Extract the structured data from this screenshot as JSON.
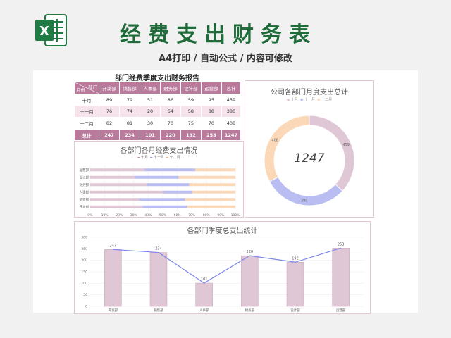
{
  "header": {
    "title": "经费支出财务表",
    "subtitle": "A4打印 / 自动公式 / 内容可修改"
  },
  "table": {
    "title": "部门经费季度支出财务报告",
    "corner_top": "部门",
    "corner_bottom": "月份",
    "columns": [
      "开发部",
      "销售部",
      "人事部",
      "财务部",
      "设计部",
      "运营部",
      "总计"
    ],
    "rows": [
      {
        "label": "十月",
        "values": [
          "89",
          "79",
          "51",
          "86",
          "59",
          "95",
          "459"
        ]
      },
      {
        "label": "十一月",
        "values": [
          "76",
          "74",
          "20",
          "64",
          "58",
          "88",
          "380"
        ]
      },
      {
        "label": "十二月",
        "values": [
          "82",
          "81",
          "30",
          "70",
          "75",
          "70",
          "408"
        ]
      }
    ],
    "total": {
      "label": "总计",
      "values": [
        "247",
        "234",
        "101",
        "220",
        "192",
        "253",
        "1247"
      ]
    }
  },
  "colors": {
    "accent": "#b97a9c",
    "pink": "#dfc7d6",
    "blue": "#b9bdf2",
    "orange": "#fbd8b8",
    "line": "#7c86e8",
    "brand_green": "#1f6b3a"
  },
  "chart_data": [
    {
      "type": "bar",
      "orientation": "horizontal",
      "stacked": "percent",
      "title": "各部门各月经费支出情况",
      "legend_position": "top",
      "categories": [
        "运营部",
        "设计部",
        "财务部",
        "人事部",
        "销售部",
        "开发部"
      ],
      "series": [
        {
          "name": "十月",
          "values": [
            95,
            59,
            86,
            51,
            79,
            89
          ]
        },
        {
          "name": "十一月",
          "values": [
            88,
            58,
            64,
            20,
            74,
            76
          ]
        },
        {
          "name": "十二月",
          "values": [
            70,
            75,
            70,
            30,
            81,
            82
          ]
        }
      ],
      "xticks": [
        "0%",
        "10%",
        "20%",
        "30%",
        "40%",
        "50%",
        "60%",
        "70%",
        "80%",
        "90%",
        "100%"
      ],
      "xlim": [
        0,
        100
      ]
    },
    {
      "type": "pie",
      "donut": true,
      "title": "公司各部门月度支出总计",
      "legend_position": "top",
      "center_label": "1247",
      "labels": [
        "十月",
        "十一月",
        "十二月"
      ],
      "values": [
        459,
        380,
        408
      ]
    },
    {
      "type": "bar",
      "title": "各部门季度总支出统计",
      "categories": [
        "开发部",
        "销售部",
        "人事部",
        "财务部",
        "设计部",
        "运营部"
      ],
      "values": [
        247,
        234,
        101,
        220,
        192,
        253
      ],
      "line_overlay": true,
      "ylim": [
        0,
        300
      ],
      "yticks": [
        "0",
        "50",
        "100",
        "150",
        "200",
        "250",
        "300"
      ],
      "grid": true
    }
  ]
}
